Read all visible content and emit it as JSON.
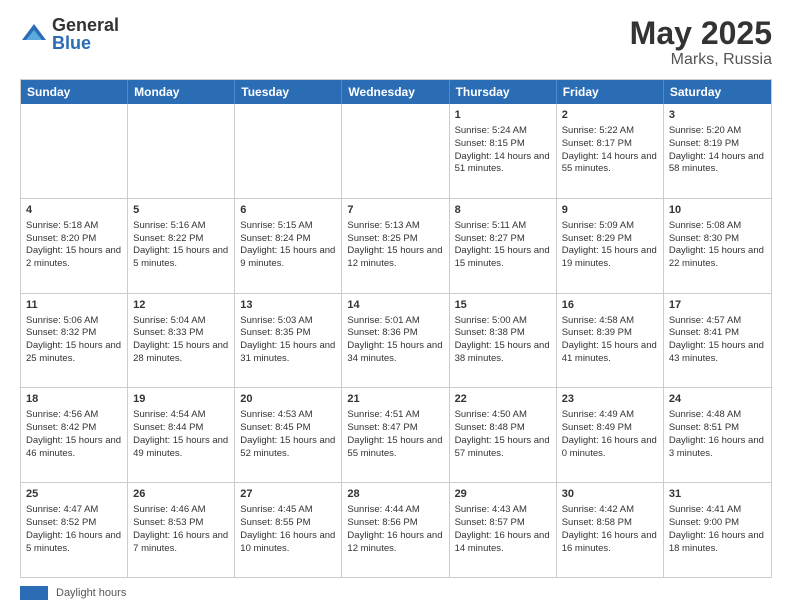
{
  "logo": {
    "general": "General",
    "blue": "Blue"
  },
  "header": {
    "month": "May 2025",
    "location": "Marks, Russia"
  },
  "weekdays": [
    "Sunday",
    "Monday",
    "Tuesday",
    "Wednesday",
    "Thursday",
    "Friday",
    "Saturday"
  ],
  "footer": {
    "label": "Daylight hours"
  },
  "weeks": [
    [
      {
        "day": "",
        "info": ""
      },
      {
        "day": "",
        "info": ""
      },
      {
        "day": "",
        "info": ""
      },
      {
        "day": "",
        "info": ""
      },
      {
        "day": "1",
        "info": "Sunrise: 5:24 AM\nSunset: 8:15 PM\nDaylight: 14 hours and 51 minutes."
      },
      {
        "day": "2",
        "info": "Sunrise: 5:22 AM\nSunset: 8:17 PM\nDaylight: 14 hours and 55 minutes."
      },
      {
        "day": "3",
        "info": "Sunrise: 5:20 AM\nSunset: 8:19 PM\nDaylight: 14 hours and 58 minutes."
      }
    ],
    [
      {
        "day": "4",
        "info": "Sunrise: 5:18 AM\nSunset: 8:20 PM\nDaylight: 15 hours and 2 minutes."
      },
      {
        "day": "5",
        "info": "Sunrise: 5:16 AM\nSunset: 8:22 PM\nDaylight: 15 hours and 5 minutes."
      },
      {
        "day": "6",
        "info": "Sunrise: 5:15 AM\nSunset: 8:24 PM\nDaylight: 15 hours and 9 minutes."
      },
      {
        "day": "7",
        "info": "Sunrise: 5:13 AM\nSunset: 8:25 PM\nDaylight: 15 hours and 12 minutes."
      },
      {
        "day": "8",
        "info": "Sunrise: 5:11 AM\nSunset: 8:27 PM\nDaylight: 15 hours and 15 minutes."
      },
      {
        "day": "9",
        "info": "Sunrise: 5:09 AM\nSunset: 8:29 PM\nDaylight: 15 hours and 19 minutes."
      },
      {
        "day": "10",
        "info": "Sunrise: 5:08 AM\nSunset: 8:30 PM\nDaylight: 15 hours and 22 minutes."
      }
    ],
    [
      {
        "day": "11",
        "info": "Sunrise: 5:06 AM\nSunset: 8:32 PM\nDaylight: 15 hours and 25 minutes."
      },
      {
        "day": "12",
        "info": "Sunrise: 5:04 AM\nSunset: 8:33 PM\nDaylight: 15 hours and 28 minutes."
      },
      {
        "day": "13",
        "info": "Sunrise: 5:03 AM\nSunset: 8:35 PM\nDaylight: 15 hours and 31 minutes."
      },
      {
        "day": "14",
        "info": "Sunrise: 5:01 AM\nSunset: 8:36 PM\nDaylight: 15 hours and 34 minutes."
      },
      {
        "day": "15",
        "info": "Sunrise: 5:00 AM\nSunset: 8:38 PM\nDaylight: 15 hours and 38 minutes."
      },
      {
        "day": "16",
        "info": "Sunrise: 4:58 AM\nSunset: 8:39 PM\nDaylight: 15 hours and 41 minutes."
      },
      {
        "day": "17",
        "info": "Sunrise: 4:57 AM\nSunset: 8:41 PM\nDaylight: 15 hours and 43 minutes."
      }
    ],
    [
      {
        "day": "18",
        "info": "Sunrise: 4:56 AM\nSunset: 8:42 PM\nDaylight: 15 hours and 46 minutes."
      },
      {
        "day": "19",
        "info": "Sunrise: 4:54 AM\nSunset: 8:44 PM\nDaylight: 15 hours and 49 minutes."
      },
      {
        "day": "20",
        "info": "Sunrise: 4:53 AM\nSunset: 8:45 PM\nDaylight: 15 hours and 52 minutes."
      },
      {
        "day": "21",
        "info": "Sunrise: 4:51 AM\nSunset: 8:47 PM\nDaylight: 15 hours and 55 minutes."
      },
      {
        "day": "22",
        "info": "Sunrise: 4:50 AM\nSunset: 8:48 PM\nDaylight: 15 hours and 57 minutes."
      },
      {
        "day": "23",
        "info": "Sunrise: 4:49 AM\nSunset: 8:49 PM\nDaylight: 16 hours and 0 minutes."
      },
      {
        "day": "24",
        "info": "Sunrise: 4:48 AM\nSunset: 8:51 PM\nDaylight: 16 hours and 3 minutes."
      }
    ],
    [
      {
        "day": "25",
        "info": "Sunrise: 4:47 AM\nSunset: 8:52 PM\nDaylight: 16 hours and 5 minutes."
      },
      {
        "day": "26",
        "info": "Sunrise: 4:46 AM\nSunset: 8:53 PM\nDaylight: 16 hours and 7 minutes."
      },
      {
        "day": "27",
        "info": "Sunrise: 4:45 AM\nSunset: 8:55 PM\nDaylight: 16 hours and 10 minutes."
      },
      {
        "day": "28",
        "info": "Sunrise: 4:44 AM\nSunset: 8:56 PM\nDaylight: 16 hours and 12 minutes."
      },
      {
        "day": "29",
        "info": "Sunrise: 4:43 AM\nSunset: 8:57 PM\nDaylight: 16 hours and 14 minutes."
      },
      {
        "day": "30",
        "info": "Sunrise: 4:42 AM\nSunset: 8:58 PM\nDaylight: 16 hours and 16 minutes."
      },
      {
        "day": "31",
        "info": "Sunrise: 4:41 AM\nSunset: 9:00 PM\nDaylight: 16 hours and 18 minutes."
      }
    ]
  ]
}
